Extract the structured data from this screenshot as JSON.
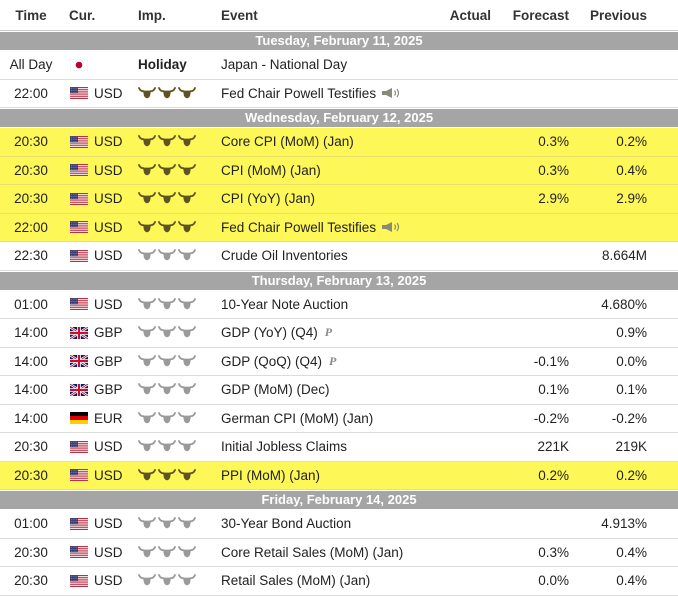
{
  "header": {
    "time": "Time",
    "currency": "Cur.",
    "importance": "Imp.",
    "event": "Event",
    "actual": "Actual",
    "forecast": "Forecast",
    "previous": "Previous"
  },
  "colors": {
    "date_bar": "#a5a5a5",
    "highlight": "#fdf758",
    "bull_high": "#5f5322",
    "bull_low": "#9a9a9a"
  },
  "rows": [
    {
      "type": "date",
      "label": "Tuesday, February 11, 2025"
    },
    {
      "type": "event",
      "time": "All Day",
      "flag": "jp",
      "currency": "",
      "importance_text": "Holiday",
      "event": "Japan - National Day",
      "actual": "",
      "forecast": "",
      "previous": "",
      "highlight": false
    },
    {
      "type": "event",
      "time": "22:00",
      "flag": "us",
      "currency": "USD",
      "importance": 3,
      "event": "Fed Chair Powell Testifies",
      "icon": "speech-icon",
      "actual": "",
      "forecast": "",
      "previous": "",
      "highlight": false
    },
    {
      "type": "date",
      "label": "Wednesday, February 12, 2025"
    },
    {
      "type": "event",
      "time": "20:30",
      "flag": "us",
      "currency": "USD",
      "importance": 3,
      "event": "Core CPI (MoM) (Jan)",
      "actual": "",
      "forecast": "0.3%",
      "previous": "0.2%",
      "highlight": true
    },
    {
      "type": "event",
      "time": "20:30",
      "flag": "us",
      "currency": "USD",
      "importance": 3,
      "event": "CPI (MoM) (Jan)",
      "actual": "",
      "forecast": "0.3%",
      "previous": "0.4%",
      "highlight": true
    },
    {
      "type": "event",
      "time": "20:30",
      "flag": "us",
      "currency": "USD",
      "importance": 3,
      "event": "CPI (YoY) (Jan)",
      "actual": "",
      "forecast": "2.9%",
      "previous": "2.9%",
      "highlight": true
    },
    {
      "type": "event",
      "time": "22:00",
      "flag": "us",
      "currency": "USD",
      "importance": 3,
      "event": "Fed Chair Powell Testifies",
      "icon": "speech-icon",
      "actual": "",
      "forecast": "",
      "previous": "",
      "highlight": true
    },
    {
      "type": "event",
      "time": "22:30",
      "flag": "us",
      "currency": "USD",
      "importance": 2,
      "event": "Crude Oil Inventories",
      "actual": "",
      "forecast": "",
      "previous": "8.664M",
      "highlight": false
    },
    {
      "type": "date",
      "label": "Thursday, February 13, 2025"
    },
    {
      "type": "event",
      "time": "01:00",
      "flag": "us",
      "currency": "USD",
      "importance": 2,
      "event": "10-Year Note Auction",
      "actual": "",
      "forecast": "",
      "previous": "4.680%",
      "highlight": false
    },
    {
      "type": "event",
      "time": "14:00",
      "flag": "gb",
      "currency": "GBP",
      "importance": 2,
      "event": "GDP (YoY) (Q4)",
      "prelim": "P",
      "actual": "",
      "forecast": "",
      "previous": "0.9%",
      "highlight": false
    },
    {
      "type": "event",
      "time": "14:00",
      "flag": "gb",
      "currency": "GBP",
      "importance": 2,
      "event": "GDP (QoQ) (Q4)",
      "prelim": "P",
      "actual": "",
      "forecast": "-0.1%",
      "previous": "0.0%",
      "highlight": false
    },
    {
      "type": "event",
      "time": "14:00",
      "flag": "gb",
      "currency": "GBP",
      "importance": 2,
      "event": "GDP (MoM) (Dec)",
      "actual": "",
      "forecast": "0.1%",
      "previous": "0.1%",
      "highlight": false
    },
    {
      "type": "event",
      "time": "14:00",
      "flag": "de",
      "currency": "EUR",
      "importance": 2,
      "event": "German CPI (MoM) (Jan)",
      "actual": "",
      "forecast": "-0.2%",
      "previous": "-0.2%",
      "highlight": false
    },
    {
      "type": "event",
      "time": "20:30",
      "flag": "us",
      "currency": "USD",
      "importance": 2,
      "event": "Initial Jobless Claims",
      "actual": "",
      "forecast": "221K",
      "previous": "219K",
      "highlight": false
    },
    {
      "type": "event",
      "time": "20:30",
      "flag": "us",
      "currency": "USD",
      "importance": 3,
      "event": "PPI (MoM) (Jan)",
      "actual": "",
      "forecast": "0.2%",
      "previous": "0.2%",
      "highlight": true
    },
    {
      "type": "date",
      "label": "Friday, February 14, 2025"
    },
    {
      "type": "event",
      "time": "01:00",
      "flag": "us",
      "currency": "USD",
      "importance": 2,
      "event": "30-Year Bond Auction",
      "actual": "",
      "forecast": "",
      "previous": "4.913%",
      "highlight": false
    },
    {
      "type": "event",
      "time": "20:30",
      "flag": "us",
      "currency": "USD",
      "importance": 2,
      "event": "Core Retail Sales (MoM) (Jan)",
      "actual": "",
      "forecast": "0.3%",
      "previous": "0.4%",
      "highlight": false
    },
    {
      "type": "event",
      "time": "20:30",
      "flag": "us",
      "currency": "USD",
      "importance": 2,
      "event": "Retail Sales (MoM) (Jan)",
      "actual": "",
      "forecast": "0.0%",
      "previous": "0.4%",
      "highlight": false
    }
  ]
}
